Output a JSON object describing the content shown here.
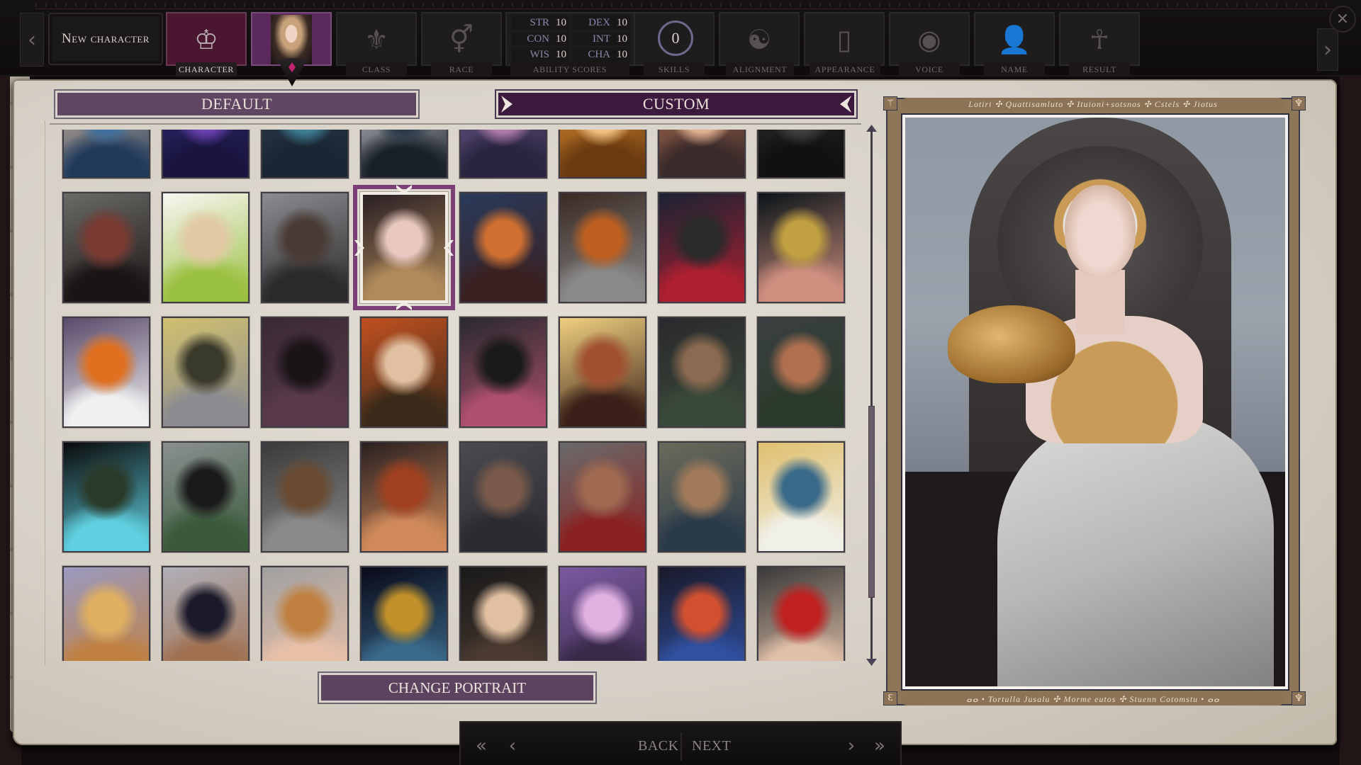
{
  "header": {
    "title": "New character",
    "prev_icon": "chevron-left-icon",
    "next_icon": "chevron-right-icon",
    "close_icon": "close-icon",
    "steps": [
      {
        "id": "character",
        "label": "CHARACTER",
        "icon": "character-crest-icon",
        "glyph": "♔",
        "state": "active"
      },
      {
        "id": "portrait",
        "label": "",
        "icon": "portrait-thumbnail",
        "glyph": "",
        "state": "current"
      },
      {
        "id": "class",
        "label": "CLASS",
        "icon": "class-crest-icon",
        "glyph": "⚜",
        "state": "locked"
      },
      {
        "id": "race",
        "label": "RACE",
        "icon": "gender-race-icon",
        "glyph": "⚥",
        "state": "locked"
      },
      {
        "id": "ability_scores",
        "label": "ABILITY SCORES",
        "state": "locked"
      },
      {
        "id": "skills",
        "label": "SKILLS",
        "value": "0",
        "state": "locked"
      },
      {
        "id": "alignment",
        "label": "ALIGNMENT",
        "icon": "yin-yang-icon",
        "glyph": "☯",
        "state": "locked"
      },
      {
        "id": "appearance",
        "label": "APPEARANCE",
        "icon": "mirror-icon",
        "glyph": "▯",
        "state": "locked"
      },
      {
        "id": "voice",
        "label": "VOICE",
        "icon": "voice-icon",
        "glyph": "◉",
        "state": "locked"
      },
      {
        "id": "name",
        "label": "NAME",
        "icon": "person-silhouette-icon",
        "glyph": "👤",
        "state": "locked"
      },
      {
        "id": "result",
        "label": "RESULT",
        "icon": "ankh-icon",
        "glyph": "☥",
        "state": "locked"
      }
    ],
    "abilities": [
      {
        "key": "STR",
        "value": "10"
      },
      {
        "key": "DEX",
        "value": "10"
      },
      {
        "key": "CON",
        "value": "10"
      },
      {
        "key": "INT",
        "value": "10"
      },
      {
        "key": "WIS",
        "value": "10"
      },
      {
        "key": "CHA",
        "value": "10"
      }
    ]
  },
  "tabs": {
    "default_label": "DEFAULT",
    "custom_label": "CUSTOM",
    "active": "custom"
  },
  "portraits": {
    "selected_index": 11,
    "scroll_position": {
      "thumb_start": 0.52,
      "thumb_end": 0.88
    },
    "items": [
      {
        "desc": "young man in blue",
        "tones": [
          "#e8c8a8",
          "#3f6f9e",
          "#203a5c"
        ]
      },
      {
        "desc": "hooded figure purple neon",
        "tones": [
          "#2a2a6a",
          "#6a3fb0",
          "#1a1540"
        ]
      },
      {
        "desc": "figure in teal coat",
        "tones": [
          "#2a3a4c",
          "#3d7e94",
          "#1a2633"
        ]
      },
      {
        "desc": "white-haired figure",
        "tones": [
          "#d8dce0",
          "#2a3a4c",
          "#1a2028"
        ]
      },
      {
        "desc": "purple-lit face",
        "tones": [
          "#6a5a8a",
          "#b07aa8",
          "#2a2440"
        ]
      },
      {
        "desc": "amber portrait",
        "tones": [
          "#e09030",
          "#f0c080",
          "#6a3a10"
        ]
      },
      {
        "desc": "woman with braids",
        "tones": [
          "#b07050",
          "#e0b090",
          "#3a2a2a"
        ]
      },
      {
        "desc": "dark rogue",
        "tones": [
          "#2a2a2a",
          "#404040",
          "#111111"
        ]
      },
      {
        "desc": "masked woman, red braid",
        "tones": [
          "#6a6a66",
          "#7a3a32",
          "#1a1414"
        ]
      },
      {
        "desc": "blonde elf woman",
        "tones": [
          "#f8f6f2",
          "#e2c9a4",
          "#9ac040"
        ]
      },
      {
        "desc": "short-haired woman",
        "tones": [
          "#8a8c90",
          "#4a3a34",
          "#2a2a2a"
        ]
      },
      {
        "desc": "curly-haired woman (selected)",
        "tones": [
          "#2a2024",
          "#e8c8c0",
          "#b08a5a"
        ]
      },
      {
        "desc": "orc warrior, fiery",
        "tones": [
          "#2a3a5a",
          "#d07030",
          "#3a2020"
        ]
      },
      {
        "desc": "armored demon, fire",
        "tones": [
          "#3a2a24",
          "#c06020",
          "#8a8a8a"
        ]
      },
      {
        "desc": "dark-haired man",
        "tones": [
          "#1a2233",
          "#2a2a2a",
          "#b02030"
        ]
      },
      {
        "desc": "woman with golden hair",
        "tones": [
          "#0a1418",
          "#c0a040",
          "#d09080"
        ]
      },
      {
        "desc": "orange-haired girl with bow",
        "tones": [
          "#5a4a6a",
          "#e07020",
          "#f0f0f0"
        ]
      },
      {
        "desc": "vampire with gold crown",
        "tones": [
          "#d0c070",
          "#3a3a2a",
          "#8a8a90"
        ]
      },
      {
        "desc": "hooded masked figure",
        "tones": [
          "#3a2a34",
          "#1a1418",
          "#5a3a4a"
        ]
      },
      {
        "desc": "woman on autumn leaves",
        "tones": [
          "#c05020",
          "#e0c0a0",
          "#3a2a1a"
        ]
      },
      {
        "desc": "horned shadow",
        "tones": [
          "#2a2a2e",
          "#1a1a1c",
          "#b05070"
        ]
      },
      {
        "desc": "figure in sunset light",
        "tones": [
          "#f0d080",
          "#a05030",
          "#3a2018"
        ]
      },
      {
        "desc": "bald bearded man",
        "tones": [
          "#2a2a2c",
          "#8a6a50",
          "#3a4a3a"
        ]
      },
      {
        "desc": "woman with circlet",
        "tones": [
          "#3a4040",
          "#b07050",
          "#2a3a2a"
        ]
      },
      {
        "desc": "hooded elf, glowing hand",
        "tones": [
          "#0a0a0a",
          "#2a3a2a",
          "#60d0e0"
        ]
      },
      {
        "desc": "black-haired woman",
        "tones": [
          "#8a9090",
          "#1a1a1a",
          "#3a5a3a"
        ]
      },
      {
        "desc": "armored dark-skinned man",
        "tones": [
          "#3a3a3a",
          "#6a4a30",
          "#8a8a8a"
        ]
      },
      {
        "desc": "red-bearded dwarf",
        "tones": [
          "#2a2020",
          "#a04020",
          "#d08a5a"
        ]
      },
      {
        "desc": "bearded man with scar",
        "tones": [
          "#4a4a50",
          "#7a5a4a",
          "#2a2a30"
        ]
      },
      {
        "desc": "young man in armor",
        "tones": [
          "#6a6a6a",
          "#a06a50",
          "#8a2020"
        ]
      },
      {
        "desc": "man with mustache",
        "tones": [
          "#6a6a5a",
          "#a07a5a",
          "#2a3a4a"
        ]
      },
      {
        "desc": "egyptian queen",
        "tones": [
          "#e0c070",
          "#3a6a8a",
          "#f0f0e8"
        ]
      },
      {
        "desc": "golden-bearded dwarf",
        "tones": [
          "#9a9ac0",
          "#e0b060",
          "#c08040"
        ]
      },
      {
        "desc": "man in black turban",
        "tones": [
          "#b0b0b8",
          "#1a1a2a",
          "#a07050"
        ]
      },
      {
        "desc": "woman with tiara",
        "tones": [
          "#a0a0a0",
          "#c08040",
          "#e8c0a8"
        ]
      },
      {
        "desc": "pharaoh",
        "tones": [
          "#0a0a1a",
          "#c0902a",
          "#3a6a8a"
        ]
      },
      {
        "desc": "black-haired woman",
        "tones": [
          "#1a1a1a",
          "#e0c0a0",
          "#4a3a30"
        ]
      },
      {
        "desc": "horned purple woman",
        "tones": [
          "#7a5aa0",
          "#e0b0e0",
          "#3a2a4a"
        ]
      },
      {
        "desc": "red-haired flower girl",
        "tones": [
          "#1a1a2a",
          "#d05030",
          "#3050a0"
        ]
      },
      {
        "desc": "red-haired warrior",
        "tones": [
          "#3a3a3a",
          "#c02020",
          "#e0c0a8"
        ]
      }
    ]
  },
  "change_portrait_label": "CHANGE PORTRAIT",
  "preview": {
    "band_top": "Lotiri ✣ Quattisamluto ✣ Ituioni+sotsnos ✣ Cstels ✣ Jiotus",
    "band_bottom": "ⴰⴰ • Tortulla Jusalu ✣ Morme eutos ✣ Stuenn Cotomstu • ⴰⴰ",
    "corner_glyphs": [
      "⚚",
      "♆",
      "Ɛ",
      "♆"
    ]
  },
  "bottom_nav": {
    "first_icon": "double-chevron-left-icon",
    "prev_icon": "chevron-left-icon",
    "back_label": "BACK",
    "next_label": "NEXT",
    "next_icon": "chevron-right-icon",
    "last_icon": "double-chevron-right-icon"
  }
}
